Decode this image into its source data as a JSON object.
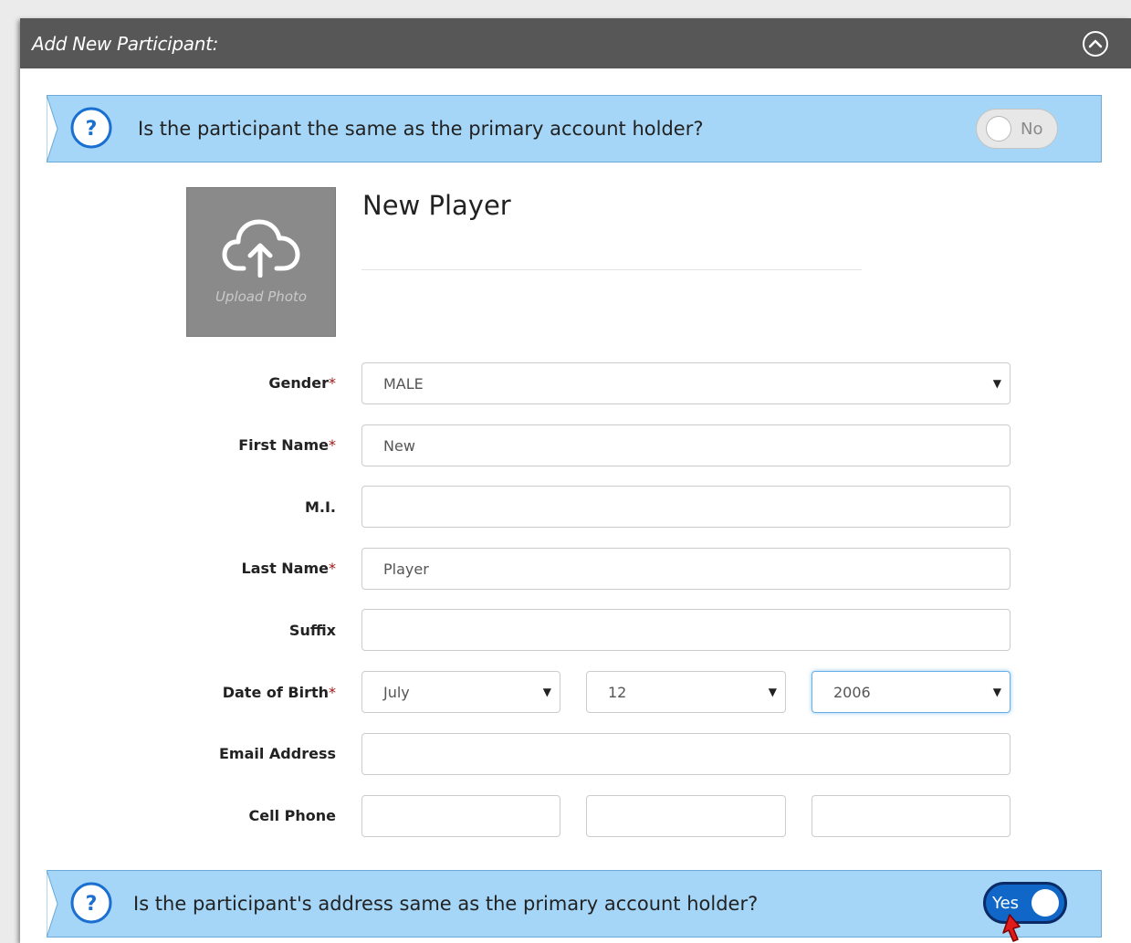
{
  "panel": {
    "title": "Add New Participant:"
  },
  "same_holder": {
    "question": "Is the participant the same as the primary account holder?",
    "toggle_label": "No",
    "toggle_on": false
  },
  "upload": {
    "label": "Upload Photo"
  },
  "player": {
    "name": "New Player"
  },
  "required_marker": "*",
  "form": {
    "gender": {
      "label": "Gender",
      "value": "MALE"
    },
    "first_name": {
      "label": "First Name",
      "value": "New"
    },
    "mi": {
      "label": "M.I.",
      "value": ""
    },
    "last_name": {
      "label": "Last Name",
      "value": "Player"
    },
    "suffix": {
      "label": "Suffix",
      "value": ""
    },
    "dob": {
      "label": "Date of Birth",
      "month": "July",
      "day": "12",
      "year": "2006"
    },
    "email": {
      "label": "Email Address",
      "value": ""
    },
    "cell_phone": {
      "label": "Cell Phone",
      "part1": "",
      "part2": "",
      "part3": ""
    }
  },
  "same_address": {
    "question": "Is the participant's address same as the primary account holder?",
    "toggle_label": "Yes",
    "toggle_on": true
  },
  "colors": {
    "header_bg": "#575757",
    "banner_bg": "#a5d6f7",
    "help_icon": "#1a6fd0",
    "toggle_on": "#1067c8",
    "required": "#a01818"
  },
  "icons": [
    "chevron-up-circle-icon",
    "help-icon",
    "cloud-upload-icon",
    "dropdown-caret-icon",
    "mouse-cursor-icon"
  ]
}
